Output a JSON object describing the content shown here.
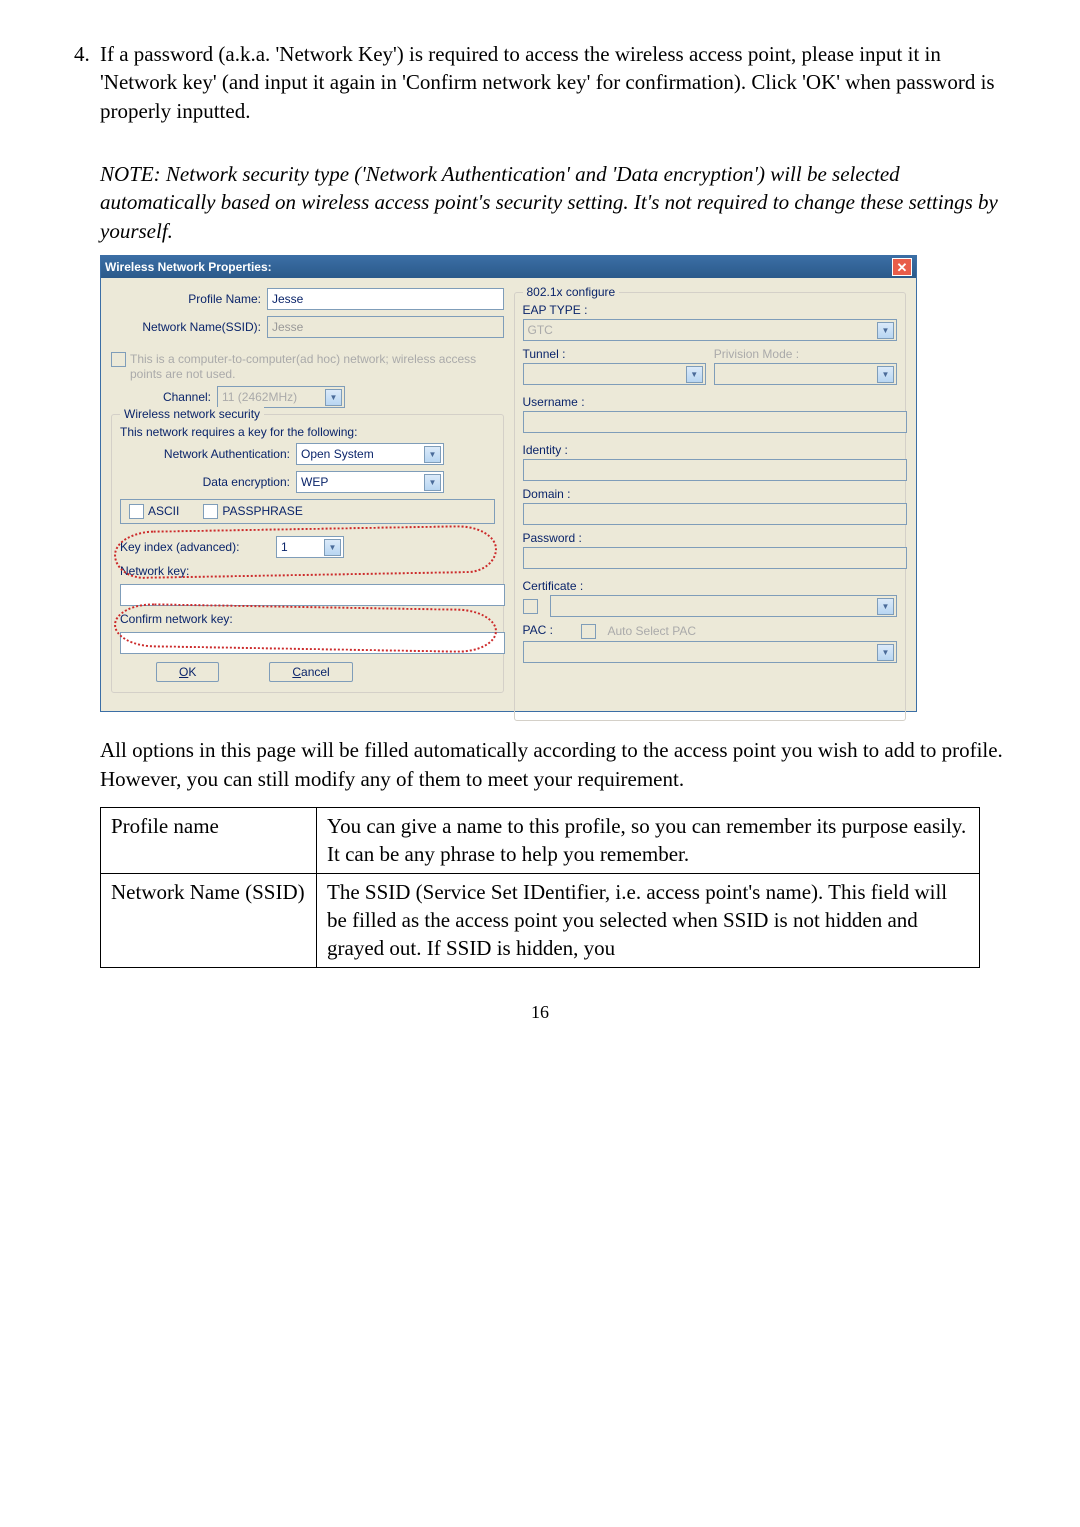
{
  "step": {
    "num": "4.",
    "text": "If a password (a.k.a. 'Network Key') is required to access the wireless access point, please input it in 'Network key' (and input it again in 'Confirm network key' for confirmation). Click 'OK' when password is properly inputted."
  },
  "note": "NOTE: Network security type ('Network Authentication' and 'Data encryption') will be selected automatically based on wireless access point's security setting. It's not required to change these settings by yourself.",
  "dialog": {
    "title": "Wireless Network Properties:",
    "left": {
      "profile_label": "Profile Name:",
      "profile_value": "Jesse",
      "ssid_label": "Network Name(SSID):",
      "ssid_value": "Jesse",
      "adhoc_text": "This is a computer-to-computer(ad hoc) network; wireless access points are not used.",
      "channel_label": "Channel:",
      "channel_value": "11 (2462MHz)",
      "security_group": "Wireless network security",
      "security_desc": "This network requires a key for the following:",
      "auth_label": "Network Authentication:",
      "auth_value": "Open System",
      "enc_label": "Data encryption:",
      "enc_value": "WEP",
      "ascii": "ASCII",
      "passphrase": "PASSPHRASE",
      "keyidx_label": "Key index (advanced):",
      "keyidx_value": "1",
      "netkey_label": "Network key:",
      "confirm_label": "Confirm network key:",
      "ok": "OK",
      "cancel": "Cancel"
    },
    "right": {
      "group": "802.1x configure",
      "eap_label": "EAP TYPE :",
      "eap_value": "GTC",
      "tunnel_label": "Tunnel :",
      "priv_label": "Privision Mode :",
      "user_label": "Username :",
      "id_label": "Identity :",
      "domain_label": "Domain :",
      "pwd_label": "Password :",
      "cert_label": "Certificate :",
      "pac_label": "PAC :",
      "pac_chk": "Auto Select PAC"
    }
  },
  "summary": "All options in this page will be filled automatically according to the access point you wish to add to profile. However, you can still modify any of them to meet your requirement.",
  "table": {
    "r1c1": "Profile name",
    "r1c2": "You can give a name to this profile, so you can remember its purpose easily. It can be any phrase to help you remember.",
    "r2c1": "Network Name (SSID)",
    "r2c2": "The SSID (Service Set IDentifier, i.e. access point's name). This field will be filled as the access point you selected when SSID is not hidden and grayed out. If SSID is hidden, you"
  },
  "pagenum": "16"
}
